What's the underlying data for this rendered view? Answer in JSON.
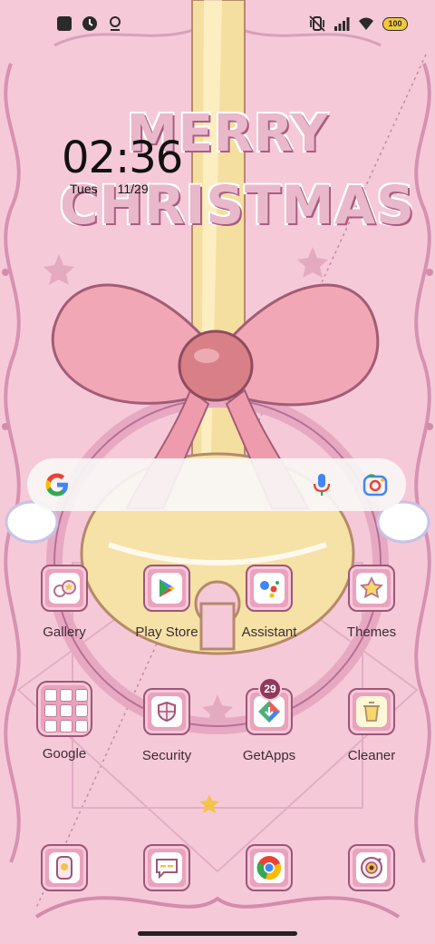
{
  "status_bar": {
    "left_icons": [
      "square-notification-icon",
      "clock-app-icon",
      "location-pin-icon"
    ],
    "right_icons": [
      "vibrate-icon",
      "signal-icon",
      "wifi-icon"
    ],
    "battery": "100"
  },
  "clock": {
    "time": "02:36",
    "day": "Tues",
    "date": "11/29"
  },
  "wallpaper_title": {
    "line1": "MERRY",
    "line2": "CHRISTMAS"
  },
  "search": {
    "icons": [
      "google-g-icon",
      "microphone-icon",
      "google-lens-icon"
    ]
  },
  "apps": [
    {
      "label": "Gallery",
      "icon": "gallery-icon"
    },
    {
      "label": "Play Store",
      "icon": "play-store-icon"
    },
    {
      "label": "Assistant",
      "icon": "assistant-icon"
    },
    {
      "label": "Themes",
      "icon": "themes-icon"
    },
    {
      "label": "Google",
      "icon": "folder-icon"
    },
    {
      "label": "Security",
      "icon": "security-icon"
    },
    {
      "label": "GetApps",
      "icon": "getapps-icon",
      "badge": "29"
    },
    {
      "label": "Cleaner",
      "icon": "cleaner-icon"
    }
  ],
  "dock": [
    {
      "icon": "phone-icon"
    },
    {
      "icon": "messages-icon"
    },
    {
      "icon": "chrome-icon"
    },
    {
      "icon": "camera-icon"
    }
  ],
  "colors": {
    "background": "#f6c9d8",
    "tile": "#eaa2bd",
    "tile_border": "#9b5778",
    "ribbon": "#f5dfa0",
    "bow": "#f2a7b6",
    "badge": "#8f3a5c"
  }
}
